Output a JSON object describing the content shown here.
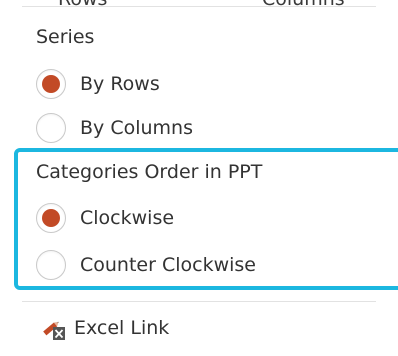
{
  "top_partial": {
    "left_text": "Rows",
    "right_text": "Columns"
  },
  "series": {
    "label": "Series",
    "options": [
      {
        "label": "By Rows",
        "checked": true
      },
      {
        "label": "By Columns",
        "checked": false
      }
    ]
  },
  "categories_order": {
    "label": "Categories Order in PPT",
    "options": [
      {
        "label": "Clockwise",
        "checked": true
      },
      {
        "label": "Counter Clockwise",
        "checked": false
      }
    ]
  },
  "excel_link": {
    "label": "Excel Link",
    "icon": "excel-link-icon"
  },
  "colors": {
    "radio_selected": "#c24a26",
    "highlight_border": "#1cb7e0"
  }
}
